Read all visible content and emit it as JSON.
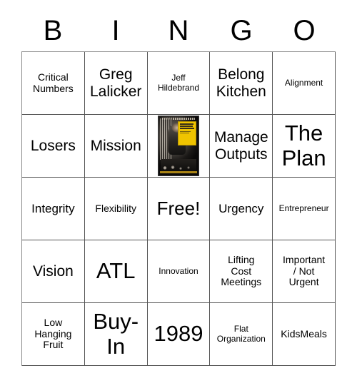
{
  "card": {
    "header_letters": [
      "B",
      "I",
      "N",
      "G",
      "O"
    ],
    "rows": [
      [
        {
          "text": "Critical\nNumbers",
          "size": "sm",
          "type": "text"
        },
        {
          "text": "Greg\nLalicker",
          "size": "lg",
          "type": "text"
        },
        {
          "text": "Jeff\nHildebrand",
          "size": "xs",
          "type": "text"
        },
        {
          "text": "Belong\nKitchen",
          "size": "lg",
          "type": "text"
        },
        {
          "text": "Alignment",
          "size": "xs",
          "type": "text"
        }
      ],
      [
        {
          "text": "Losers",
          "size": "lg",
          "type": "text"
        },
        {
          "text": "Mission",
          "size": "lg",
          "type": "text"
        },
        {
          "text": "",
          "size": "md",
          "type": "image",
          "image_name": "great-game-of-business-book-cover"
        },
        {
          "text": "Manage\nOutputs",
          "size": "lg",
          "type": "text"
        },
        {
          "text": "The\nPlan",
          "size": "xxl",
          "type": "text"
        }
      ],
      [
        {
          "text": "Integrity",
          "size": "md",
          "type": "text"
        },
        {
          "text": "Flexibility",
          "size": "sm",
          "type": "text"
        },
        {
          "text": "Free!",
          "size": "xl",
          "type": "text"
        },
        {
          "text": "Urgency",
          "size": "md",
          "type": "text"
        },
        {
          "text": "Entrepreneur",
          "size": "xs",
          "type": "text"
        }
      ],
      [
        {
          "text": "Vision",
          "size": "lg",
          "type": "text"
        },
        {
          "text": "ATL",
          "size": "xxl",
          "type": "text"
        },
        {
          "text": "Innovation",
          "size": "xs",
          "type": "text"
        },
        {
          "text": "Lifting\nCost\nMeetings",
          "size": "sm",
          "type": "text"
        },
        {
          "text": "Important\n/ Not\nUrgent",
          "size": "sm",
          "type": "text"
        }
      ],
      [
        {
          "text": "Low\nHanging\nFruit",
          "size": "sm",
          "type": "text"
        },
        {
          "text": "Buy-\nIn",
          "size": "xxl",
          "type": "text"
        },
        {
          "text": "1989",
          "size": "xxl",
          "type": "text"
        },
        {
          "text": "Flat\nOrganization",
          "size": "xs",
          "type": "text"
        },
        {
          "text": "KidsMeals",
          "size": "sm",
          "type": "text"
        }
      ]
    ]
  },
  "colors": {
    "background": "#ffffff",
    "text": "#000000",
    "grid_line": "#555555",
    "book_accent": "#f0c400"
  }
}
